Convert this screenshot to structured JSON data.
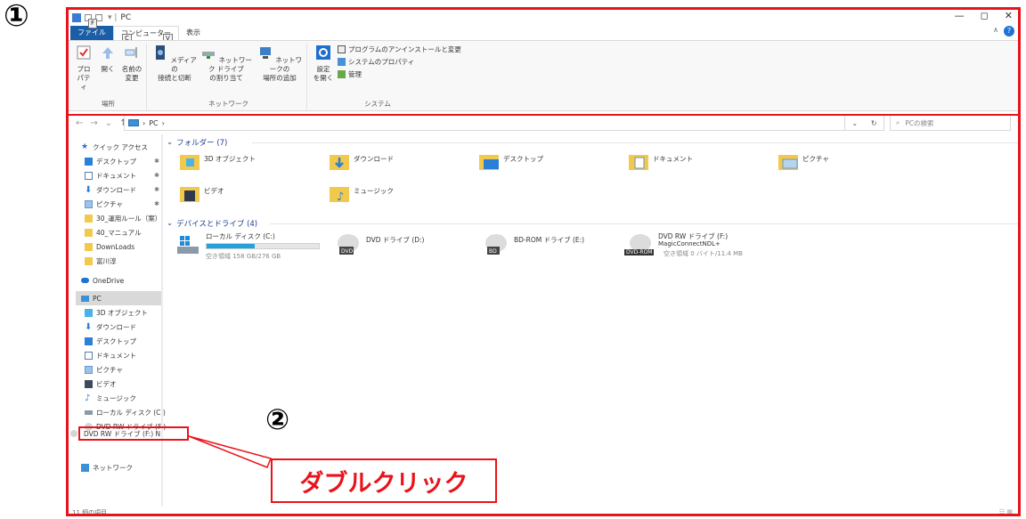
{
  "annotations": {
    "step1": "①",
    "step2": "②",
    "callout": "ダブルクリック"
  },
  "titlebar": {
    "title": "PC",
    "minimize": "—",
    "maximize": "◻",
    "close": "✕"
  },
  "tabs": {
    "file": "ファイル",
    "computer": "コンピューター",
    "view": "表示",
    "keytip_file": "F",
    "keytip_computer": "C",
    "keytip_view": "V"
  },
  "ribbon": {
    "location_group": "場所",
    "properties": "プロパティ",
    "open": "開く",
    "rename_1": "名前の",
    "rename_2": "変更",
    "network_group": "ネットワーク",
    "media_1": "メディアの",
    "media_2": "接続と切断",
    "map_1": "ネットワーク ドライブ",
    "map_2": "の割り当て",
    "add_1": "ネットワークの",
    "add_2": "場所の追加",
    "system_group": "システム",
    "settings_1": "設定",
    "settings_2": "を開く",
    "uninstall": "プログラムのアンインストールと変更",
    "sysprops": "システムのプロパティ",
    "manage": "管理"
  },
  "address": {
    "path": "PC",
    "search_placeholder": "PCの検索"
  },
  "nav": {
    "quick_access": "クイック アクセス",
    "desktop": "デスクトップ",
    "documents": "ドキュメント",
    "downloads": "ダウンロード",
    "pictures": "ピクチャ",
    "rules": "30_運用ルール（案）",
    "manual": "40_マニュアル",
    "downloads_en": "DownLoads",
    "user": "富川淳",
    "onedrive": "OneDrive",
    "pc": "PC",
    "objects3d": "3D オブジェクト",
    "pc_downloads": "ダウンロード",
    "pc_desktop": "デスクトップ",
    "pc_documents": "ドキュメント",
    "pc_pictures": "ピクチャ",
    "pc_videos": "ビデオ",
    "pc_music": "ミュージック",
    "local_disk": "ローカル ディスク (C:)",
    "dvd_rw_1": "DVD RW ドライブ (F:)",
    "dvd_rw_2": "DVD RW ドライブ (F:) N",
    "network": "ネットワーク"
  },
  "content": {
    "folders_header": "フォルダー (7)",
    "folders": [
      "3D オブジェクト",
      "ダウンロード",
      "デスクトップ",
      "ドキュメント",
      "ピクチャ",
      "ビデオ",
      "ミュージック"
    ],
    "drives_header": "デバイスとドライブ (4)",
    "drive_c_name": "ローカル ディスク (C:)",
    "drive_c_free": "空き領域 158 GB/276 GB",
    "drive_c_used_fraction": 0.43,
    "drive_d_name": "DVD ドライブ (D:)",
    "drive_e_name": "BD-ROM ドライブ (E:)",
    "drive_f_name": "DVD RW ドライブ (F:)",
    "drive_f_label": "MagicConnectNDL+",
    "drive_f_free": "空き領域 0 バイト/11.4 MB",
    "drive_f_badge": "DVD-ROM",
    "dvd_badge": "DVD",
    "bd_badge": "BD"
  },
  "status": {
    "items": "11 個の項目"
  },
  "colors": {
    "highlight": "#e8141b",
    "accent": "#1a5ea8",
    "drive_bar": "#26a0da"
  }
}
